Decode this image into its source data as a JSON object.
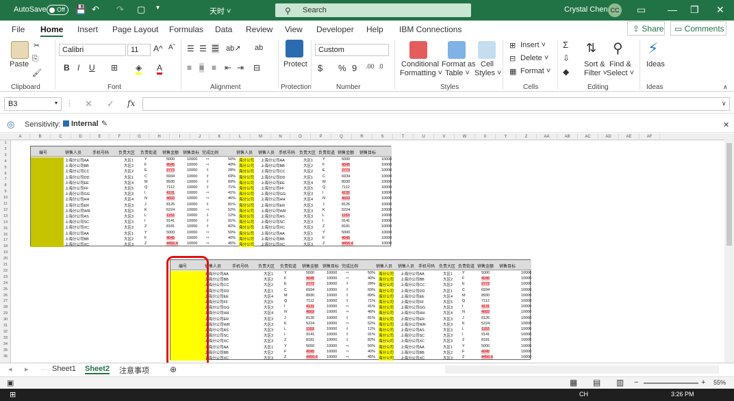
{
  "title_bar": {
    "autosave_label": "AutoSave",
    "autosave_state": "Off",
    "file_name": "天时 ˅",
    "search_placeholder": "Search",
    "user_name": "Crystal Chen",
    "user_initials": "CC"
  },
  "ribbon_tabs": [
    "File",
    "Home",
    "Insert",
    "Page Layout",
    "Formulas",
    "Data",
    "Review",
    "View",
    "Developer",
    "Help",
    "IBM Connections"
  ],
  "share_label": "Share",
  "comments_label": "Comments",
  "ribbon": {
    "clipboard": {
      "label": "Clipboard",
      "paste": "Paste"
    },
    "font": {
      "label": "Font",
      "name": "Calibri",
      "size": "11"
    },
    "alignment": {
      "label": "Alignment"
    },
    "protection": {
      "label": "Protection",
      "protect": "Protect"
    },
    "number": {
      "label": "Number",
      "format": "Custom"
    },
    "styles": {
      "label": "Styles",
      "conditional": "Conditional",
      "formatting": "Formatting ˅",
      "format_as": "Format as",
      "table": "Table ˅",
      "cell": "Cell",
      "cell_styles": "Styles ˅"
    },
    "cells": {
      "label": "Cells",
      "insert": "Insert ˅",
      "delete": "Delete ˅",
      "format": "Format ˅"
    },
    "editing": {
      "label": "Editing",
      "sort": "Sort &",
      "filter": "Filter ˅",
      "find": "Find &",
      "select": "Select ˅"
    },
    "ideas": {
      "label": "Ideas",
      "ideas": "Ideas"
    }
  },
  "name_box": "B3",
  "fx": "fx",
  "sensitivity": {
    "label": "Sensitivity:",
    "value": "Internal"
  },
  "columns": [
    "A",
    "B",
    "C",
    "D",
    "E",
    "F",
    "G",
    "H",
    "I",
    "J",
    "K",
    "L",
    "M",
    "N",
    "O",
    "P",
    "Q",
    "R",
    "S",
    "T",
    "U",
    "V",
    "W",
    "X",
    "Y",
    "Z",
    "AA",
    "AB",
    "AC",
    "AD",
    "AE",
    "AF"
  ],
  "rows": [
    "1",
    "2",
    "3",
    "4",
    "5",
    "6",
    "7",
    "8",
    "9",
    "10",
    "11",
    "12",
    "13",
    "14",
    "15",
    "16",
    "17",
    "18",
    "19",
    "20",
    "21",
    "22",
    "23",
    "24",
    "25",
    "26",
    "27",
    "28",
    "29",
    "30",
    "31",
    "32",
    "33",
    "34",
    "35",
    "36"
  ],
  "table_headers": [
    "编号",
    "销售人员",
    "手机号码",
    "负责大区",
    "负责街道",
    "销售金额",
    "销售目标",
    "完成比例",
    "销售人员",
    "销售人员",
    "手机号码",
    "负责大区",
    "负责街道",
    "销售金额",
    "销售目标"
  ],
  "table_rows": [
    {
      "name": "上海分公司AA",
      "region": "大区1",
      "street": "Y",
      "amount": "5000",
      "target": "10000",
      "pct": "50%",
      "arrow": "⇨",
      "pink": false
    },
    {
      "name": "上海分公司BB",
      "region": "大区2",
      "street": "F",
      "amount": "4045",
      "target": "10000",
      "pct": "40%",
      "arrow": "⇨",
      "pink": true
    },
    {
      "name": "上海分公司CC",
      "region": "大区2",
      "street": "E",
      "amount": "2773",
      "target": "10000",
      "pct": "28%",
      "arrow": "⇩",
      "pink": true
    },
    {
      "name": "上海分公司DD",
      "region": "大区1",
      "street": "C",
      "amount": "6934",
      "target": "10000",
      "pct": "69%",
      "arrow": "⇧",
      "pink": false
    },
    {
      "name": "上海分公司EE",
      "region": "大区4",
      "street": "M",
      "amount": "8930",
      "target": "10000",
      "pct": "89%",
      "arrow": "⇧",
      "pink": false
    },
    {
      "name": "上海分公司FF",
      "region": "大区5",
      "street": "Q",
      "amount": "7112",
      "target": "10000",
      "pct": "71%",
      "arrow": "⇧",
      "pink": false
    },
    {
      "name": "上海分公司GG",
      "region": "大区3",
      "street": "I",
      "amount": "4131",
      "target": "10000",
      "pct": "41%",
      "arrow": "⇨",
      "pink": true
    },
    {
      "name": "上海分公司HH",
      "region": "大区4",
      "street": "N",
      "amount": "4603",
      "target": "10000",
      "pct": "46%",
      "arrow": "⇨",
      "pink": true
    },
    {
      "name": "上海分公司ER",
      "region": "大区3",
      "street": "J",
      "amount": "8126",
      "target": "10000",
      "pct": "81%",
      "arrow": "⇧",
      "pink": false
    },
    {
      "name": "上海分公司WR",
      "region": "大区3",
      "street": "K",
      "amount": "5224",
      "target": "10000",
      "pct": "52%",
      "arrow": "⇨",
      "pink": false
    },
    {
      "name": "上海分公司AS",
      "region": "大区3",
      "street": "L",
      "amount": "1153",
      "target": "10000",
      "pct": "12%",
      "arrow": "⇩",
      "pink": true
    },
    {
      "name": "上海分公司SC",
      "region": "大区3",
      "street": "I",
      "amount": "9141",
      "target": "10000",
      "pct": "91%",
      "arrow": "⇧",
      "pink": false
    },
    {
      "name": "上海分公司XC",
      "region": "大区3",
      "street": "Z",
      "amount": "8181",
      "target": "10000",
      "pct": "82%",
      "arrow": "⇧",
      "pink": false
    },
    {
      "name": "上海分公司AA",
      "region": "大区1",
      "street": "Y",
      "amount": "5000",
      "target": "10000",
      "pct": "50%",
      "arrow": "⇨",
      "pink": false
    },
    {
      "name": "上海分公司BB",
      "region": "大区2",
      "street": "F",
      "amount": "4045",
      "target": "10000",
      "pct": "40%",
      "arrow": "⇨",
      "pink": true
    },
    {
      "name": "上海分公司XC",
      "region": "大区3",
      "street": "Z",
      "amount": "4456.4",
      "target": "10000",
      "pct": "45%",
      "arrow": "⇨",
      "pink": true
    }
  ],
  "sheets": [
    "Sheet1",
    "Sheet2",
    "注意事项"
  ],
  "status": {
    "zoom": "55%"
  },
  "taskbar": {
    "lang": "CH",
    "time": "3:26 PM"
  },
  "colors": {
    "excel_green": "#217346",
    "highlight": "#ffff00",
    "pink": "#f4b8bd",
    "callout": "#e01010"
  }
}
